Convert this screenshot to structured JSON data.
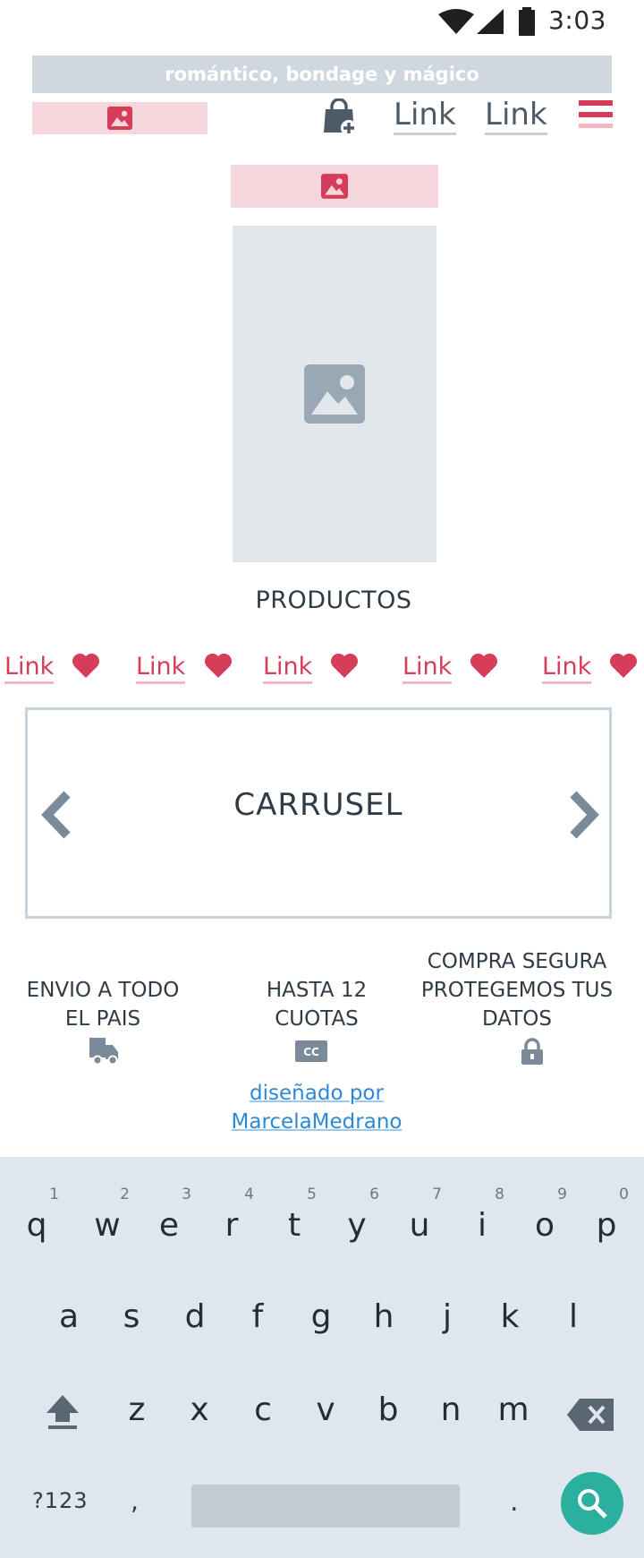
{
  "status_bar": {
    "time": "3:03"
  },
  "header": {
    "banner_text": "romántico, bondage y mágico",
    "nav_links": [
      "Link",
      "Link"
    ]
  },
  "section": {
    "products_title": "PRODUCTOS",
    "product_links": [
      "Link",
      "Link",
      "Link",
      "Link",
      "Link"
    ],
    "carousel_label": "CARRUSEL"
  },
  "features": [
    {
      "line1": "ENVIO A TODO",
      "line2": "EL PAIS",
      "line3": ""
    },
    {
      "line1": "HASTA 12",
      "line2": "CUOTAS",
      "line3": ""
    },
    {
      "line1": "COMPRA SEGURA",
      "line2": "PROTEGEMOS TUS",
      "line3": "DATOS"
    }
  ],
  "credit": {
    "line1": "diseñado por",
    "line2": "MarcelaMedrano"
  },
  "keyboard": {
    "row1": [
      "q",
      "w",
      "e",
      "r",
      "t",
      "y",
      "u",
      "i",
      "o",
      "p"
    ],
    "row1_hints": [
      "1",
      "2",
      "3",
      "4",
      "5",
      "6",
      "7",
      "8",
      "9",
      "0"
    ],
    "row2": [
      "a",
      "s",
      "d",
      "f",
      "g",
      "h",
      "j",
      "k",
      "l"
    ],
    "row3": [
      "z",
      "x",
      "c",
      "v",
      "b",
      "n",
      "m"
    ],
    "symbols_key": "?123",
    "comma_key": ",",
    "period_key": "."
  },
  "colors": {
    "accent_pink": "#d63d58",
    "link_gray": "#4d5b68",
    "search_button": "#2bb0a0",
    "credit_link": "#2d89d6"
  },
  "icons": [
    "wifi-icon",
    "signal-icon",
    "battery-icon",
    "image-icon",
    "shopping-bag-add-icon",
    "hamburger-menu-icon",
    "heart-icon",
    "chevron-left-icon",
    "chevron-right-icon",
    "truck-icon",
    "credit-card-icon",
    "lock-icon",
    "shift-icon",
    "backspace-icon",
    "search-icon"
  ]
}
